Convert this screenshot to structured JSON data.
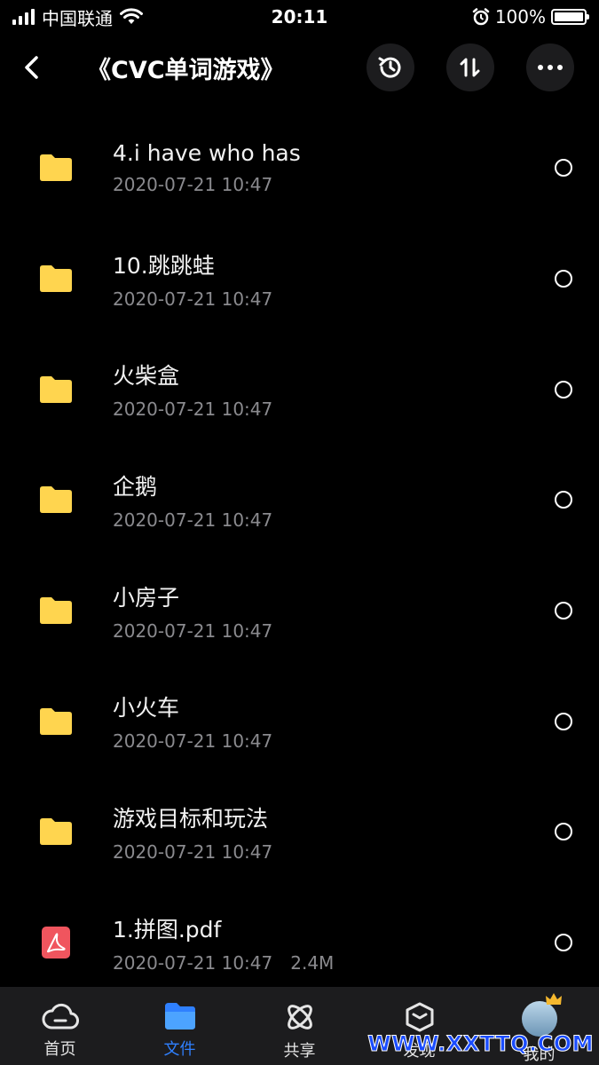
{
  "status_bar": {
    "carrier": "中国联通",
    "time": "20:11",
    "battery_percent": "100%",
    "battery_level": 1.0
  },
  "header": {
    "title": "《CVC单词游戏》",
    "icons": [
      "back-arrow-icon",
      "history-icon",
      "sort-icon",
      "more-icon"
    ]
  },
  "files": [
    {
      "name": "4.i have who has",
      "date": "2020-07-21 10:47",
      "size": "",
      "type": "folder"
    },
    {
      "name": "10.跳跳蛙",
      "date": "2020-07-21 10:47",
      "size": "",
      "type": "folder"
    },
    {
      "name": "火柴盒",
      "date": "2020-07-21 10:47",
      "size": "",
      "type": "folder"
    },
    {
      "name": "企鹅",
      "date": "2020-07-21 10:47",
      "size": "",
      "type": "folder"
    },
    {
      "name": "小房子",
      "date": "2020-07-21 10:47",
      "size": "",
      "type": "folder"
    },
    {
      "name": "小火车",
      "date": "2020-07-21 10:47",
      "size": "",
      "type": "folder"
    },
    {
      "name": "游戏目标和玩法",
      "date": "2020-07-21 10:47",
      "size": "",
      "type": "folder"
    },
    {
      "name": "1.拼图.pdf",
      "date": "2020-07-21 10:47",
      "size": "2.4M",
      "type": "pdf"
    }
  ],
  "tabs": [
    {
      "label": "首页",
      "icon": "cloud-icon",
      "active": false
    },
    {
      "label": "文件",
      "icon": "folder-icon",
      "active": true
    },
    {
      "label": "共享",
      "icon": "atom-icon",
      "active": false
    },
    {
      "label": "发现",
      "icon": "box-icon",
      "active": false
    },
    {
      "label": "我的",
      "icon": "avatar",
      "active": false
    }
  ],
  "watermark": "WWW.XXTTQ.COM",
  "colors": {
    "background": "#000000",
    "folder": "#ffd54f",
    "pdf": "#f0555e",
    "accent": "#2f80ff",
    "tab_bar": "#1c1c1e"
  }
}
